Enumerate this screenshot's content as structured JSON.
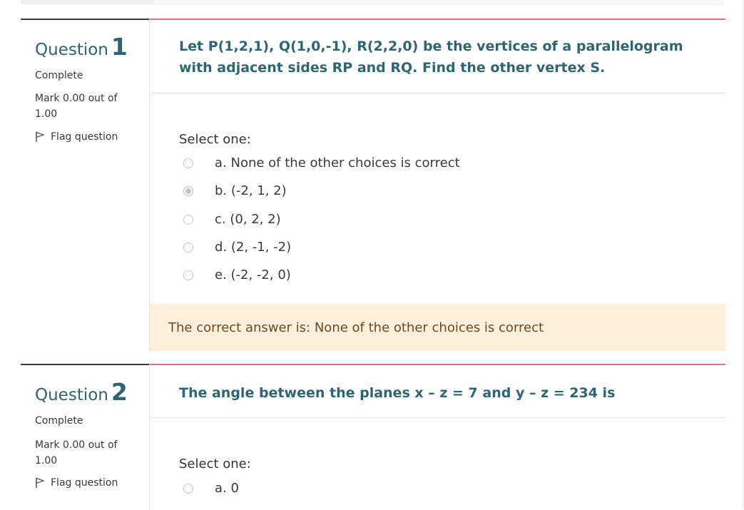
{
  "questions": [
    {
      "label": "Question",
      "number": "1",
      "state": "Complete",
      "grade": "Mark 0.00 out of 1.00",
      "flag_label": "Flag question",
      "text": "Let P(1,2,1), Q(1,0,-1), R(2,2,0) be the vertices of a parallelogram with adjacent sides RP and RQ. Find the other vertex S.",
      "prompt": "Select one:",
      "options": [
        {
          "label": "a. None of the other choices is correct",
          "selected": false
        },
        {
          "label": "b. (-2, 1, 2)",
          "selected": true
        },
        {
          "label": "c. (0, 2, 2)",
          "selected": false
        },
        {
          "label": "d. (2, -1, -2)",
          "selected": false
        },
        {
          "label": "e. (-2, -2, 0)",
          "selected": false
        }
      ],
      "feedback": "The correct answer is: None of the other choices is correct"
    },
    {
      "label": "Question",
      "number": "2",
      "state": "Complete",
      "grade": "Mark 0.00 out of 1.00",
      "flag_label": "Flag question",
      "text": "The angle between the planes x – z = 7 and y – z = 234 is",
      "prompt": "Select one:",
      "options": [
        {
          "label": "a. 0",
          "selected": false
        }
      ]
    }
  ],
  "icons": {
    "flag": "flag-outline-icon"
  },
  "colors": {
    "question_title": "#2f6473",
    "content_border": "#e8707a",
    "feedback_bg": "#fcefdc"
  }
}
